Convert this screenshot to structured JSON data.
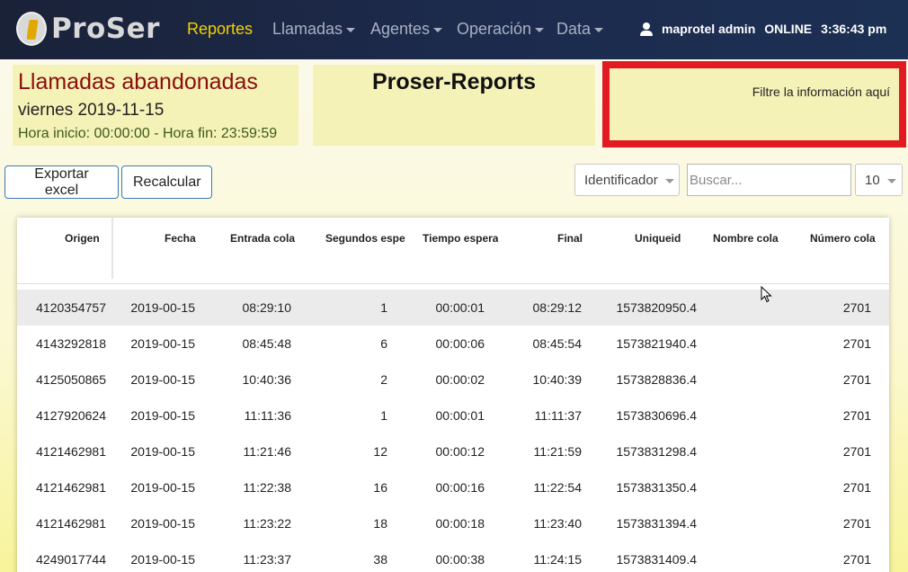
{
  "nav": {
    "logo_text": "ProSer",
    "items": [
      {
        "label": "Reportes",
        "active": true,
        "dropdown": false
      },
      {
        "label": "Llamadas",
        "active": false,
        "dropdown": true
      },
      {
        "label": "Agentes",
        "active": false,
        "dropdown": true
      },
      {
        "label": "Operación",
        "active": false,
        "dropdown": true
      },
      {
        "label": "Data",
        "active": false,
        "dropdown": true
      }
    ],
    "user": "maprotel admin",
    "status": "ONLINE",
    "time": "3:36:43 pm"
  },
  "report": {
    "title": "Llamadas abandonadas",
    "date": "viernes 2019-11-15",
    "hours": "Hora inicio: 00:00:00 - Hora fin: 23:59:59"
  },
  "brand_panel": {
    "title": "Proser-Reports"
  },
  "filter_panel": {
    "text": "Filtre la información aquí"
  },
  "toolbar": {
    "export_label": "Exportar excel",
    "recalc_label": "Recalcular",
    "field_select": "Identificador",
    "search_placeholder": "Buscar...",
    "page_size": "10"
  },
  "table": {
    "columns": [
      "Origen",
      "Fecha",
      "Entrada cola",
      "Segundos espera",
      "Tiempo espera",
      "Final",
      "Uniqueid",
      "Nombre cola",
      "Número cola"
    ],
    "rows": [
      [
        "4120354757",
        "2019-00-15",
        "08:29:10",
        "1",
        "00:00:01",
        "08:29:12",
        "1573820950.4",
        "",
        "2701"
      ],
      [
        "4143292818",
        "2019-00-15",
        "08:45:48",
        "6",
        "00:00:06",
        "08:45:54",
        "1573821940.4",
        "",
        "2701"
      ],
      [
        "4125050865",
        "2019-00-15",
        "10:40:36",
        "2",
        "00:00:02",
        "10:40:39",
        "1573828836.4",
        "",
        "2701"
      ],
      [
        "4127920624",
        "2019-00-15",
        "11:11:36",
        "1",
        "00:00:01",
        "11:11:37",
        "1573830696.4",
        "",
        "2701"
      ],
      [
        "4121462981",
        "2019-00-15",
        "11:21:46",
        "12",
        "00:00:12",
        "11:21:59",
        "1573831298.4",
        "",
        "2701"
      ],
      [
        "4121462981",
        "2019-00-15",
        "11:22:38",
        "16",
        "00:00:16",
        "11:22:54",
        "1573831350.4",
        "",
        "2701"
      ],
      [
        "4121462981",
        "2019-00-15",
        "11:23:22",
        "18",
        "00:00:18",
        "11:23:40",
        "1573831394.4",
        "",
        "2701"
      ],
      [
        "4249017744",
        "2019-00-15",
        "11:23:37",
        "38",
        "00:00:38",
        "11:24:15",
        "1573831409.4",
        "",
        "2701"
      ]
    ]
  },
  "colors": {
    "accent": "#f1d200",
    "nav_bg": "#1c2a4c",
    "highlight_border": "#e21b22",
    "title_red": "#8b0d0d"
  }
}
